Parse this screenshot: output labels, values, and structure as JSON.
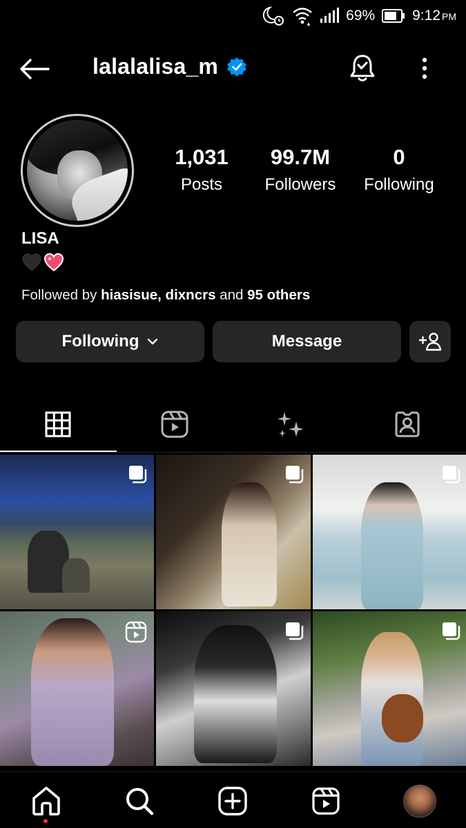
{
  "status_bar": {
    "battery_percent": "69%",
    "time": "9:12",
    "ampm": "PM",
    "icons": [
      "moon-alarm-icon",
      "wifi-icon",
      "signal-icon",
      "battery-icon"
    ]
  },
  "header": {
    "username": "lalalalisa_m",
    "verified": true,
    "icons": [
      "back-arrow-icon",
      "verified-badge-icon",
      "notification-bell-icon",
      "more-options-icon"
    ]
  },
  "profile": {
    "display_name": "LISA",
    "bio_emojis": [
      "black-heart",
      "sparkling-heart"
    ],
    "stats": [
      {
        "value": "1,031",
        "label": "Posts"
      },
      {
        "value": "99.7M",
        "label": "Followers"
      },
      {
        "value": "0",
        "label": "Following"
      }
    ],
    "followed_by": {
      "prefix": "Followed by ",
      "user1": "hiasisue",
      "separator": ", ",
      "user2": "dixncrs",
      "middle": " and ",
      "others": "95 others"
    }
  },
  "actions": {
    "following_label": "Following",
    "message_label": "Message"
  },
  "tabs": [
    {
      "name": "posts-grid",
      "icon": "grid-icon",
      "active": true
    },
    {
      "name": "reels",
      "icon": "reels-icon",
      "active": false
    },
    {
      "name": "ai-sparkles",
      "icon": "sparkles-icon",
      "active": false
    },
    {
      "name": "tagged",
      "icon": "tagged-person-icon",
      "active": false
    }
  ],
  "posts": [
    {
      "type": "carousel",
      "badge_icon": "carousel-icon"
    },
    {
      "type": "carousel",
      "badge_icon": "carousel-icon"
    },
    {
      "type": "carousel",
      "badge_icon": "carousel-icon"
    },
    {
      "type": "reel",
      "badge_icon": "reel-icon"
    },
    {
      "type": "carousel",
      "badge_icon": "carousel-icon"
    },
    {
      "type": "carousel",
      "badge_icon": "carousel-icon"
    }
  ],
  "bottom_nav": {
    "items": [
      "home-icon",
      "search-icon",
      "create-icon",
      "reels-icon",
      "profile-avatar"
    ],
    "active": "home",
    "notification_dot_color": "#ff3040"
  },
  "colors": {
    "background": "#000000",
    "button_bg": "#262626",
    "verified_blue": "#0095f6"
  }
}
